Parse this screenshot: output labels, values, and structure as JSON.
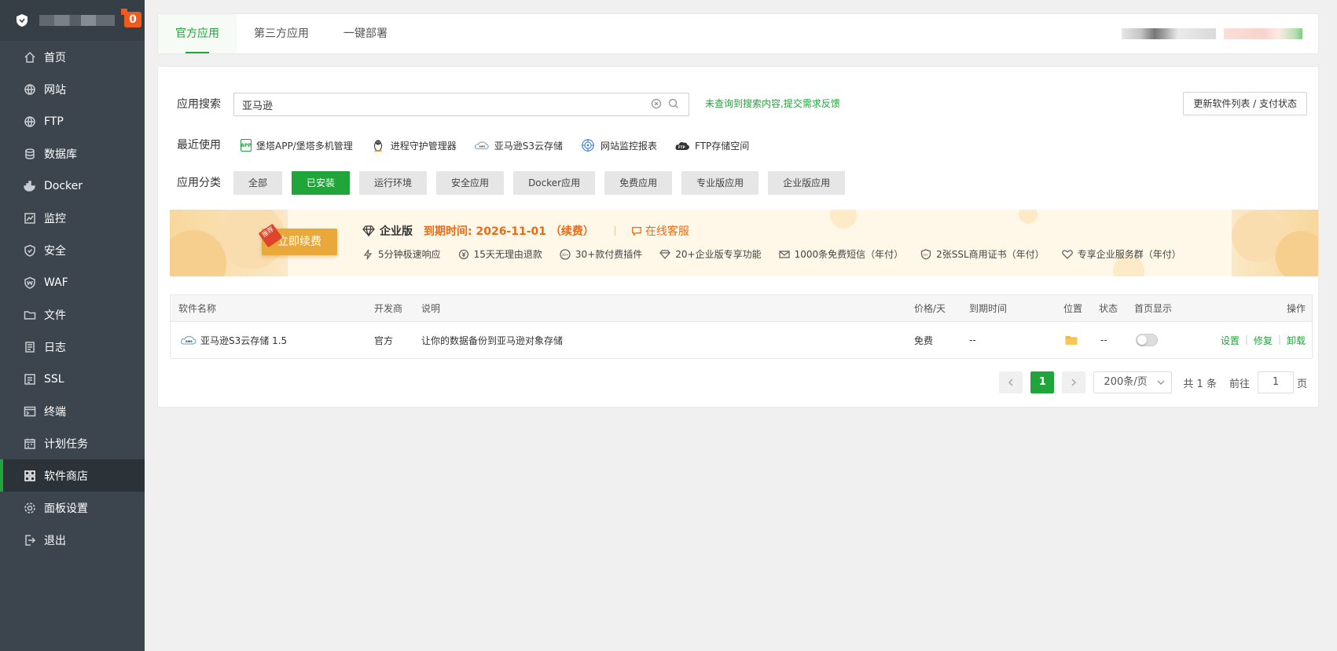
{
  "sidebar": {
    "badge": "0",
    "items": [
      {
        "label": "首页",
        "icon": "home-icon"
      },
      {
        "label": "网站",
        "icon": "globe-icon"
      },
      {
        "label": "FTP",
        "icon": "ftp-globe-icon"
      },
      {
        "label": "数据库",
        "icon": "database-icon"
      },
      {
        "label": "Docker",
        "icon": "docker-icon"
      },
      {
        "label": "监控",
        "icon": "monitor-icon"
      },
      {
        "label": "安全",
        "icon": "shield-icon"
      },
      {
        "label": "WAF",
        "icon": "waf-shield-icon"
      },
      {
        "label": "文件",
        "icon": "folder-icon"
      },
      {
        "label": "日志",
        "icon": "log-icon"
      },
      {
        "label": "SSL",
        "icon": "ssl-icon"
      },
      {
        "label": "终端",
        "icon": "terminal-icon"
      },
      {
        "label": "计划任务",
        "icon": "calendar-icon"
      },
      {
        "label": "软件商店",
        "icon": "grid-icon",
        "active": true
      },
      {
        "label": "面板设置",
        "icon": "gear-icon"
      },
      {
        "label": "退出",
        "icon": "logout-icon"
      }
    ]
  },
  "tabs": [
    "官方应用",
    "第三方应用",
    "一键部署"
  ],
  "search": {
    "label": "应用搜索",
    "value": "亚马逊",
    "feedback": "未查询到搜索内容,提交需求反馈",
    "update_button": "更新软件列表 / 支付状态"
  },
  "recent": {
    "label": "最近使用",
    "items": [
      {
        "label": "堡塔APP/堡塔多机管理",
        "icon": "app-icon"
      },
      {
        "label": "进程守护管理器",
        "icon": "linux-penguin-icon"
      },
      {
        "label": "亚马逊S3云存储",
        "icon": "aws-cloud-icon"
      },
      {
        "label": "网站监控报表",
        "icon": "monitor-target-icon"
      },
      {
        "label": "FTP存储空间",
        "icon": "ftp-cloud-icon"
      }
    ]
  },
  "categories": {
    "label": "应用分类",
    "items": [
      "全部",
      "已安装",
      "运行环境",
      "安全应用",
      "Docker应用",
      "免费应用",
      "专业版应用",
      "企业版应用"
    ],
    "active_index": 1
  },
  "banner": {
    "renew_button": "立即续费",
    "renew_tag": "推荐",
    "edition": "企业版",
    "expire": "到期时间: 2026-11-01 （续费）",
    "service": "在线客服",
    "features": [
      "5分钟极速响应",
      "15天无理由退款",
      "30+款付费插件",
      "20+企业版专享功能",
      "1000条免费短信（年付）",
      "2张SSL商用证书（年付）",
      "专享企业服务群（年付）"
    ]
  },
  "table": {
    "headers": {
      "name": "软件名称",
      "developer": "开发商",
      "desc": "说明",
      "price": "价格/天",
      "expire": "到期时间",
      "location": "位置",
      "status": "状态",
      "homepage": "首页显示",
      "ops": "操作"
    },
    "rows": [
      {
        "name": "亚马逊S3云存储 1.5",
        "developer": "官方",
        "desc": "让你的数据备份到亚马逊对象存储",
        "price": "免费",
        "expire": "--",
        "status": "--",
        "homepage_enabled": false,
        "ops": [
          "设置",
          "修复",
          "卸载"
        ]
      }
    ]
  },
  "pagination": {
    "current": "1",
    "page_size": "200条/页",
    "total": "共 1 条",
    "goto_label": "前往",
    "goto_value": "1",
    "page_unit": "页"
  },
  "colors": {
    "accent": "#20a53a",
    "sidebar_bg": "#3c444d",
    "warning": "#e76c17"
  }
}
